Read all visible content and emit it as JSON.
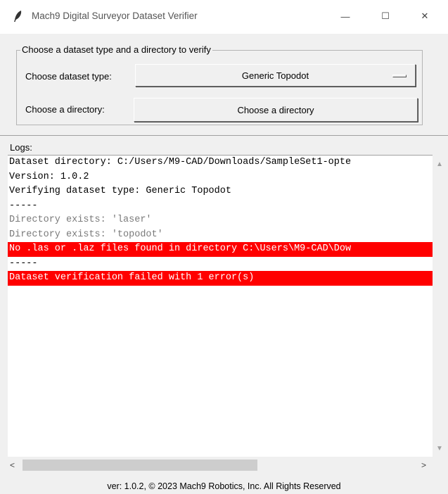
{
  "window": {
    "title": "Mach9 Digital Surveyor Dataset Verifier",
    "minimize_symbol": "—",
    "maximize_symbol": "☐",
    "close_symbol": "✕"
  },
  "group": {
    "legend": "Choose a dataset type and a directory to verify",
    "type_label": "Choose dataset type:",
    "type_selected": "Generic Topodot",
    "dir_label": "Choose a directory:",
    "dir_button": "Choose a directory"
  },
  "logs": {
    "label": "Logs:",
    "lines": [
      {
        "text": "Dataset directory: C:/Users/M9-CAD/Downloads/SampleSet1-opte",
        "kind": "info"
      },
      {
        "text": "Version: 1.0.2",
        "kind": "info"
      },
      {
        "text": "Verifying dataset type: Generic Topodot",
        "kind": "info"
      },
      {
        "text": "-----",
        "kind": "info"
      },
      {
        "text": "Directory exists: 'laser'",
        "kind": "ok"
      },
      {
        "text": "Directory exists: 'topodot'",
        "kind": "ok"
      },
      {
        "text": "No .las or .laz files found in directory C:\\Users\\M9-CAD\\Dow",
        "kind": "error"
      },
      {
        "text": "-----",
        "kind": "info"
      },
      {
        "text": "Dataset verification failed with 1 error(s)",
        "kind": "error"
      }
    ]
  },
  "footer": "ver: 1.0.2, © 2023 Mach9 Robotics, Inc. All Rights Reserved",
  "colors": {
    "error_bg": "#ff0000",
    "error_fg": "#ffffff",
    "ok_fg": "#7a7a7a"
  }
}
